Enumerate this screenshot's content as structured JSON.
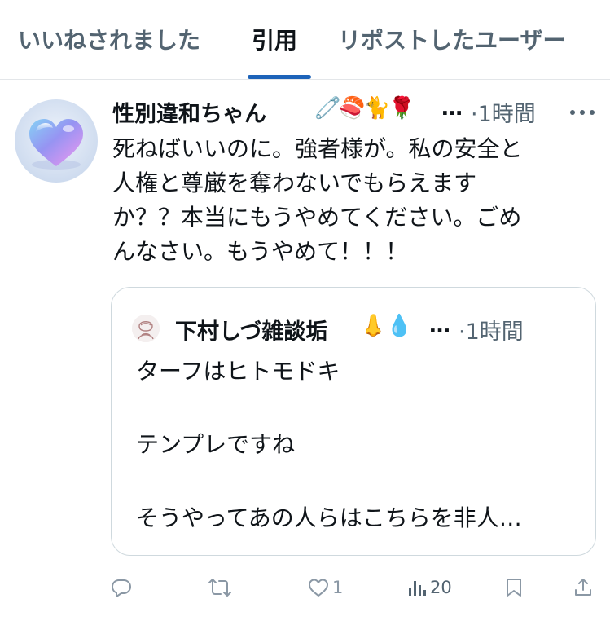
{
  "tabs": {
    "liked": "いいねされました",
    "quotes": "引用",
    "reposts": "リポストしたユーザー",
    "active": "quotes"
  },
  "post": {
    "author_name": "性別違和ちゃん",
    "name_emojis": "🧷🍣🐈🌹",
    "name_ellipsis": "…",
    "time": "·1時間",
    "body": "死ねばいいのに。強者様が。私の安全と\n人権と尊厳を奪わないでもらえます\nか？？本当にもうやめてください。ごめ\nんなさい。もうやめて！！！",
    "avatar_icon": "heart-avatar",
    "more_icon": "more-icon"
  },
  "quote": {
    "author_name": "下村しづ雑談垢",
    "name_emojis": "👃💧",
    "name_ellipsis": "…",
    "time": "·1時間",
    "body": "ターフはヒトモドキ\n\nテンプレですね\n\nそうやってあの人らはこちらを非人…"
  },
  "actions": {
    "reply_icon": "reply-icon",
    "repost_icon": "repost-icon",
    "like_icon": "like-icon",
    "like_count": "1",
    "views_icon": "views-icon",
    "views_count": "20",
    "bookmark_icon": "bookmark-icon",
    "share_icon": "share-icon"
  },
  "colors": {
    "accent": "#1d63b9",
    "muted": "#536471",
    "border": "#cfd9de",
    "text": "#0f1419"
  }
}
